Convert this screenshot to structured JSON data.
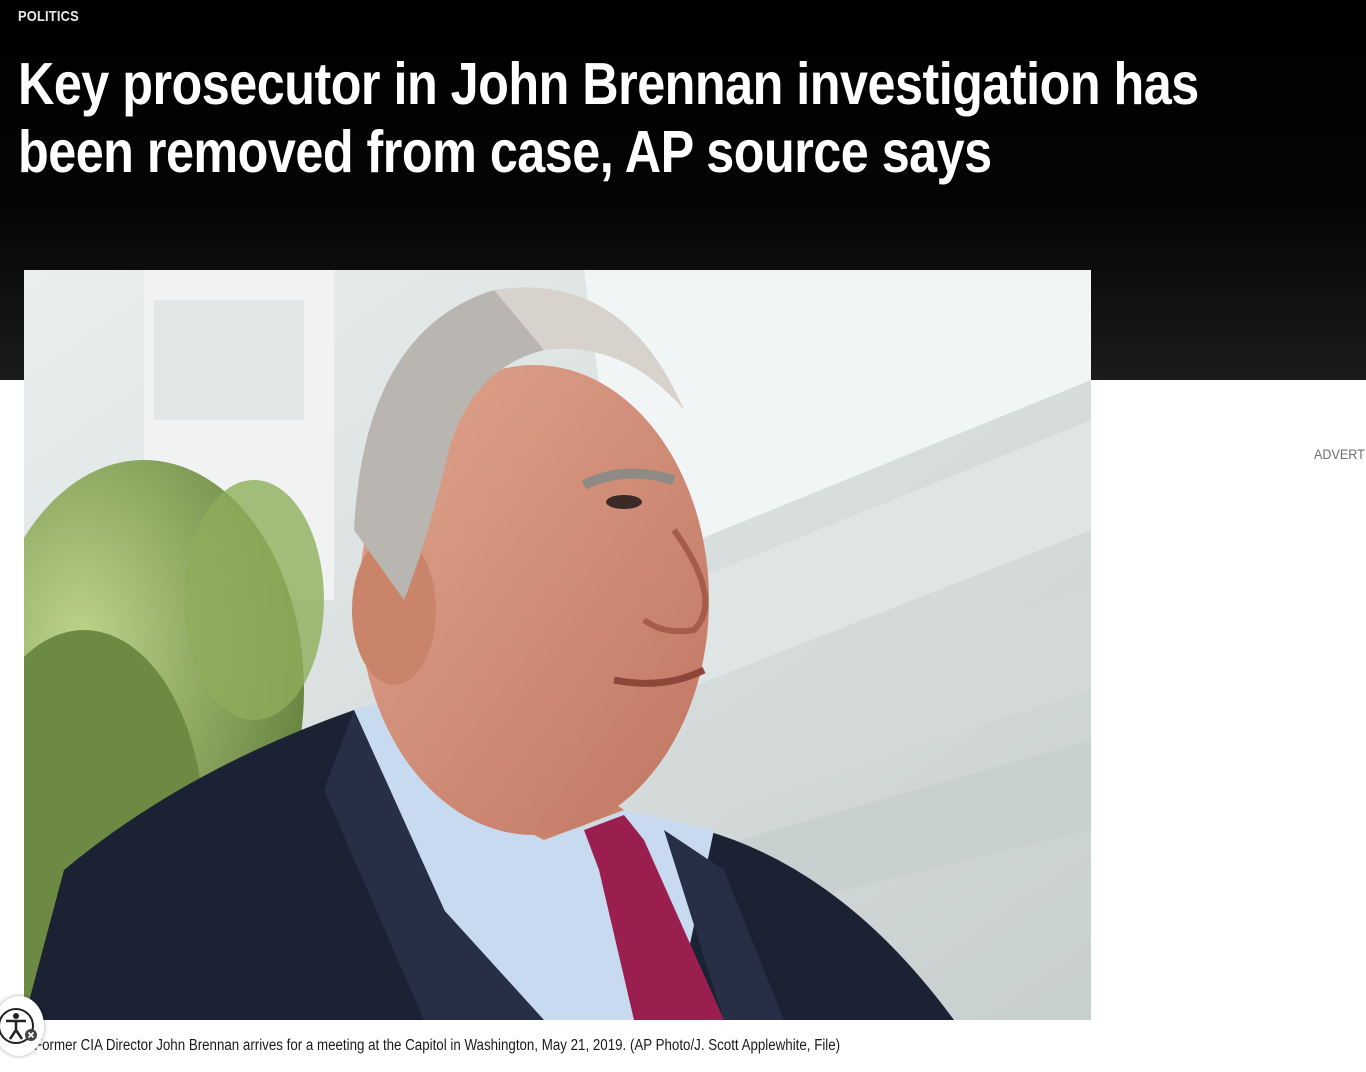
{
  "article": {
    "section_label": "POLITICS",
    "headline": "Key prosecutor in John Brennan investigation has been removed from case, AP source says",
    "photo_caption": "Former CIA Director John Brennan arrives for a meeting at the Capitol in Washington, May 21, 2019. (AP Photo/J. Scott Applewhite, File)"
  },
  "sidebar": {
    "ad_label": "ADVERTISEMENT"
  },
  "widgets": {
    "accessibility_icon": "accessibility-person-icon",
    "accessibility_badge_icon": "close-icon"
  },
  "colors": {
    "hero_background": "#000000",
    "headline_text": "#ffffff",
    "suit": "#1b2233",
    "tie": "#9a1f4f",
    "shirt": "#c7daf0"
  }
}
